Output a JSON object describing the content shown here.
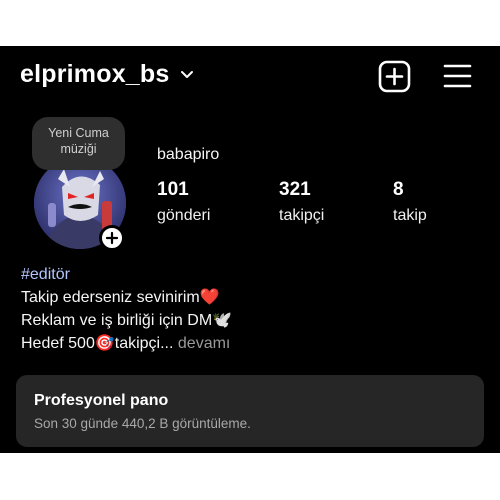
{
  "header": {
    "username": "elprimox_bs",
    "icons": [
      "chevron-down-icon",
      "add-post-icon",
      "hamburger-menu-icon"
    ]
  },
  "note": {
    "line1": "Yeni Cuma",
    "line2": "müziği"
  },
  "profile": {
    "full_name": "babapiro",
    "stats": [
      {
        "value": "101",
        "label": "gönderi"
      },
      {
        "value": "321",
        "label": "takipçi"
      },
      {
        "value": "8",
        "label": "takip"
      }
    ]
  },
  "bio": {
    "hashtag": "#editör",
    "line1": "Takip ederseniz sevinirim❤️",
    "line2": "Reklam ve iş birliği için DM🕊️",
    "line3": "Hedef 500🎯takipçi...",
    "more": " devamı"
  },
  "pro_dashboard": {
    "title": "Profesyonel pano",
    "subtitle": "Son 30 günde 440,2 B görüntüleme."
  },
  "colors": {
    "background": "#000000",
    "card": "#262626",
    "hashtag": "#b3c5ff",
    "muted": "#a8a8a8"
  }
}
